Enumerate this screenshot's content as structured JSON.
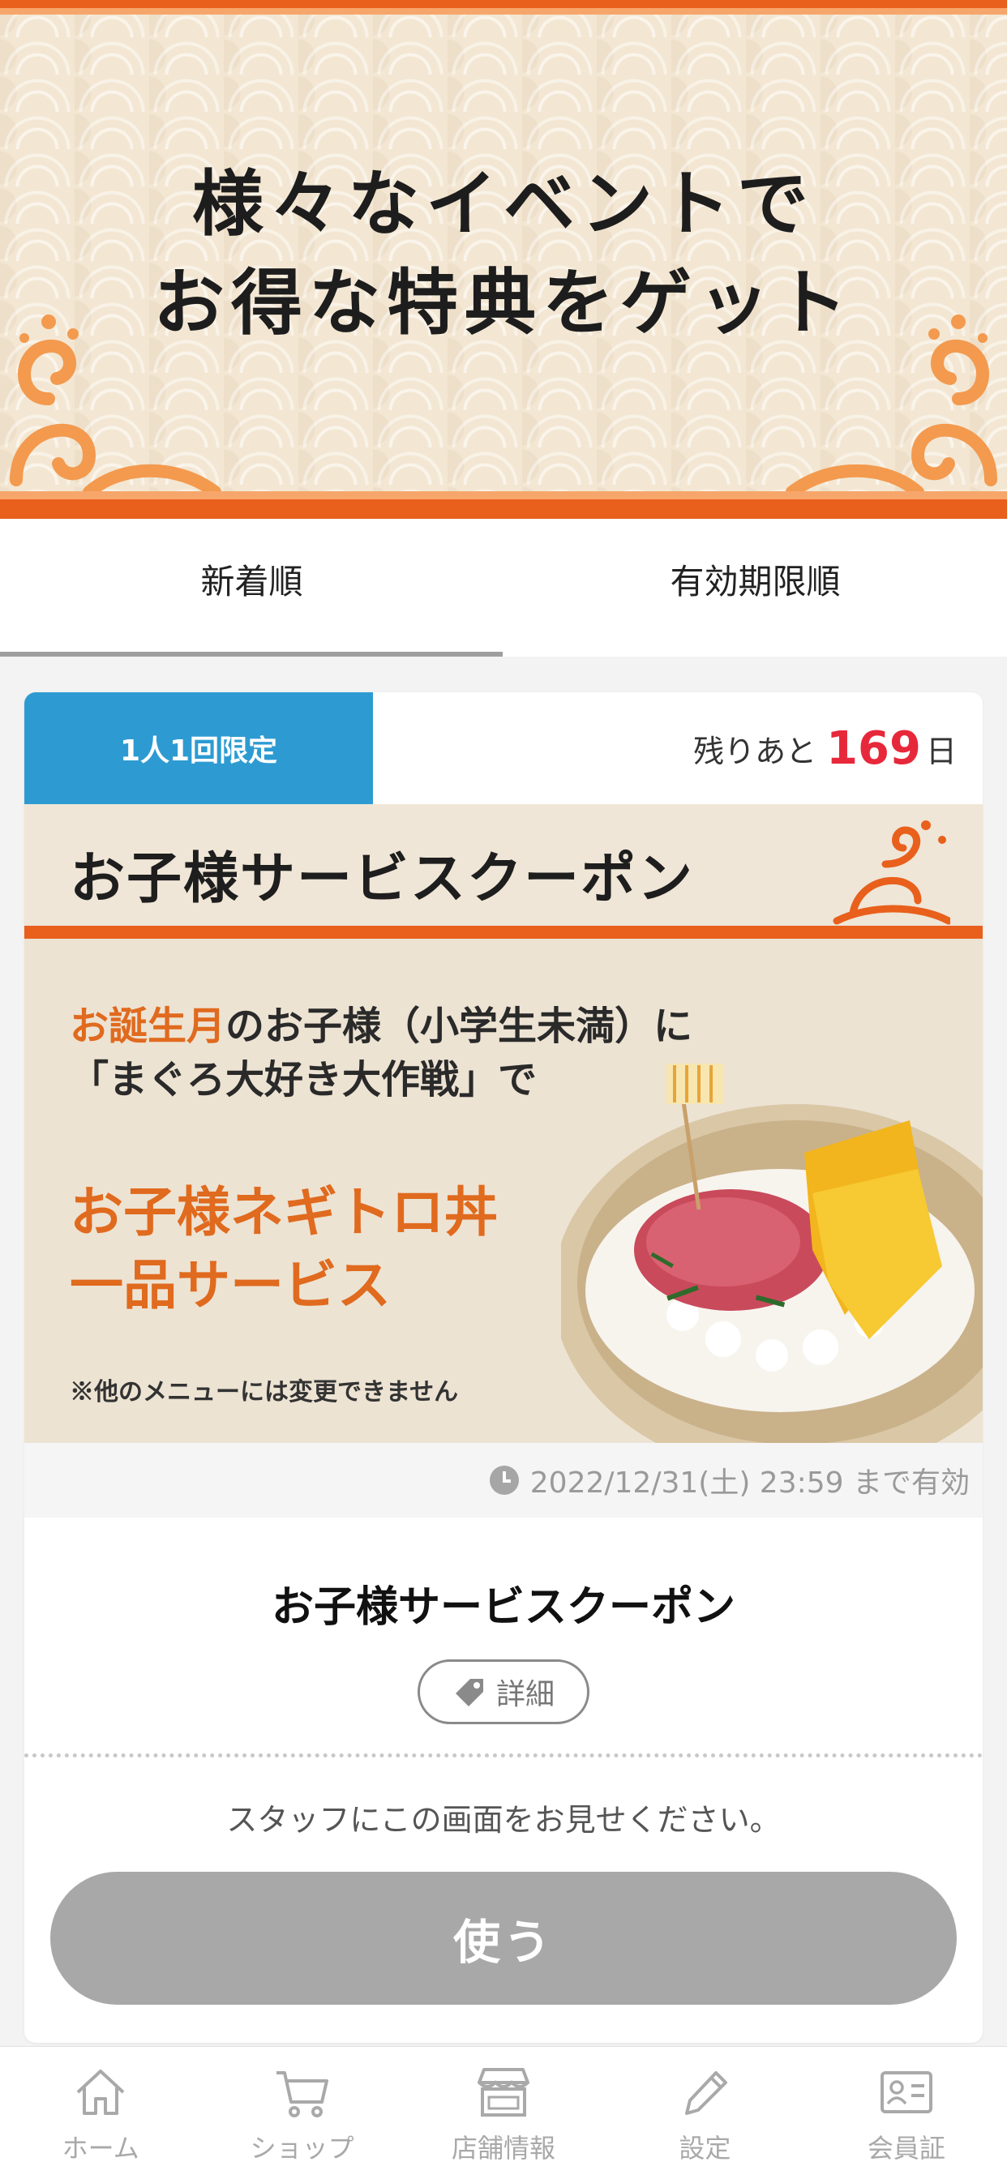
{
  "banner": {
    "title_line1": "様々なイベントで",
    "title_line2": "お得な特典をゲット"
  },
  "tabs": [
    {
      "label": "新着順",
      "active": true
    },
    {
      "label": "有効期限順",
      "active": false
    }
  ],
  "coupon": {
    "limit_badge": "1人1回限定",
    "remaining_prefix": "残りあと",
    "remaining_days": "169",
    "remaining_suffix": "日",
    "image": {
      "header_title": "お子様サービスクーポン",
      "line1_highlight": "お誕生月",
      "line1_rest": "のお子様（小学生未満）に",
      "line2": "「まぐろ大好き大作戦」で",
      "line3": "お子様ネギトロ丼",
      "line4": "一品サービス",
      "note": "※他のメニューには変更できません"
    },
    "expiry": "2022/12/31(土) 23:59 まで有効",
    "title": "お子様サービスクーポン",
    "detail_label": "詳細",
    "staff_note": "スタッフにこの画面をお見せください。",
    "use_label": "使う"
  },
  "nav": [
    {
      "label": "ホーム",
      "icon": "home-icon"
    },
    {
      "label": "ショップ",
      "icon": "cart-icon"
    },
    {
      "label": "店舗情報",
      "icon": "store-icon"
    },
    {
      "label": "設定",
      "icon": "pencil-icon"
    },
    {
      "label": "会員証",
      "icon": "member-card-icon"
    }
  ],
  "colors": {
    "accent_orange": "#e8601c",
    "badge_blue": "#2d9bd2",
    "days_red": "#e7283b",
    "use_button_disabled": "#a8a8a8"
  }
}
